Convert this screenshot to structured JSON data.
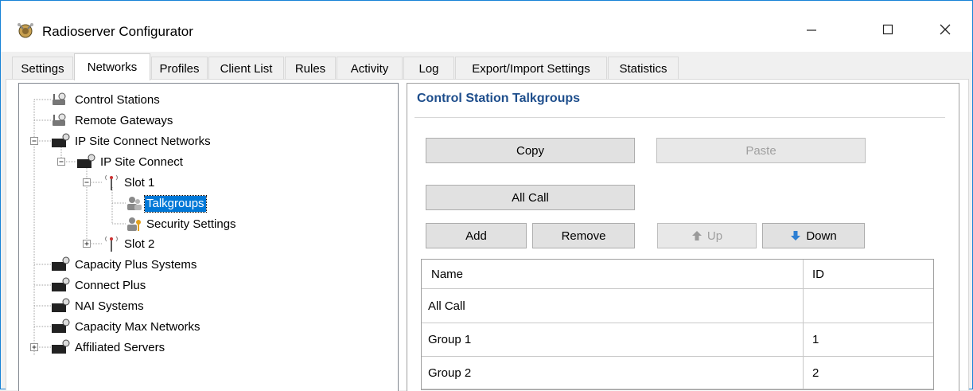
{
  "window": {
    "title": "Radioserver Configurator",
    "icon": "radioserver-app-icon",
    "caption_buttons": [
      "minimize",
      "maximize",
      "close"
    ]
  },
  "tabs": [
    {
      "label": "Settings",
      "active": false
    },
    {
      "label": "Networks",
      "active": true
    },
    {
      "label": "Profiles",
      "active": false
    },
    {
      "label": "Client List",
      "active": false
    },
    {
      "label": "Rules",
      "active": false
    },
    {
      "label": "Activity",
      "active": false
    },
    {
      "label": "Log",
      "active": false
    },
    {
      "label": "Export/Import Settings",
      "active": false
    },
    {
      "label": "Statistics",
      "active": false
    }
  ],
  "tree": [
    {
      "label": "Control Stations",
      "icon": "control-station-icon",
      "level": 0
    },
    {
      "label": "Remote Gateways",
      "icon": "control-station-icon",
      "level": 0
    },
    {
      "label": "IP Site Connect Networks",
      "icon": "network-icon",
      "level": 0,
      "expanded": true
    },
    {
      "label": "IP Site Connect",
      "icon": "network-icon",
      "level": 1,
      "expanded": true
    },
    {
      "label": "Slot 1",
      "icon": "antenna-icon",
      "level": 2,
      "expanded": true
    },
    {
      "label": "Talkgroups",
      "icon": "talkgroups-icon",
      "level": 3,
      "selected": true
    },
    {
      "label": "Security Settings",
      "icon": "security-icon",
      "level": 3
    },
    {
      "label": "Slot 2",
      "icon": "antenna-icon",
      "level": 2,
      "expanded": false
    },
    {
      "label": "Capacity Plus Systems",
      "icon": "network-icon",
      "level": 0
    },
    {
      "label": "Connect Plus",
      "icon": "network-icon",
      "level": 0
    },
    {
      "label": "NAI Systems",
      "icon": "network-icon",
      "level": 0
    },
    {
      "label": "Capacity Max Networks",
      "icon": "network-icon",
      "level": 0
    },
    {
      "label": "Affiliated Servers",
      "icon": "network-icon",
      "level": 0,
      "expanded": false
    }
  ],
  "panel": {
    "title": "Control Station Talkgroups",
    "buttons": {
      "copy": "Copy",
      "paste": "Paste",
      "all_call": "All Call",
      "add": "Add",
      "remove": "Remove",
      "up": "Up",
      "down": "Down"
    },
    "table": {
      "columns": [
        "Name",
        "ID"
      ],
      "rows": [
        {
          "name": "All Call",
          "id": ""
        },
        {
          "name": "Group 1",
          "id": "1"
        },
        {
          "name": "Group 2",
          "id": "2"
        }
      ]
    }
  },
  "colors": {
    "selection": "#0078d7",
    "section_title": "#1e4e8c",
    "window_border": "#1883d7",
    "up_arrow": "#9a9a9a",
    "down_arrow": "#2d7fd3"
  }
}
